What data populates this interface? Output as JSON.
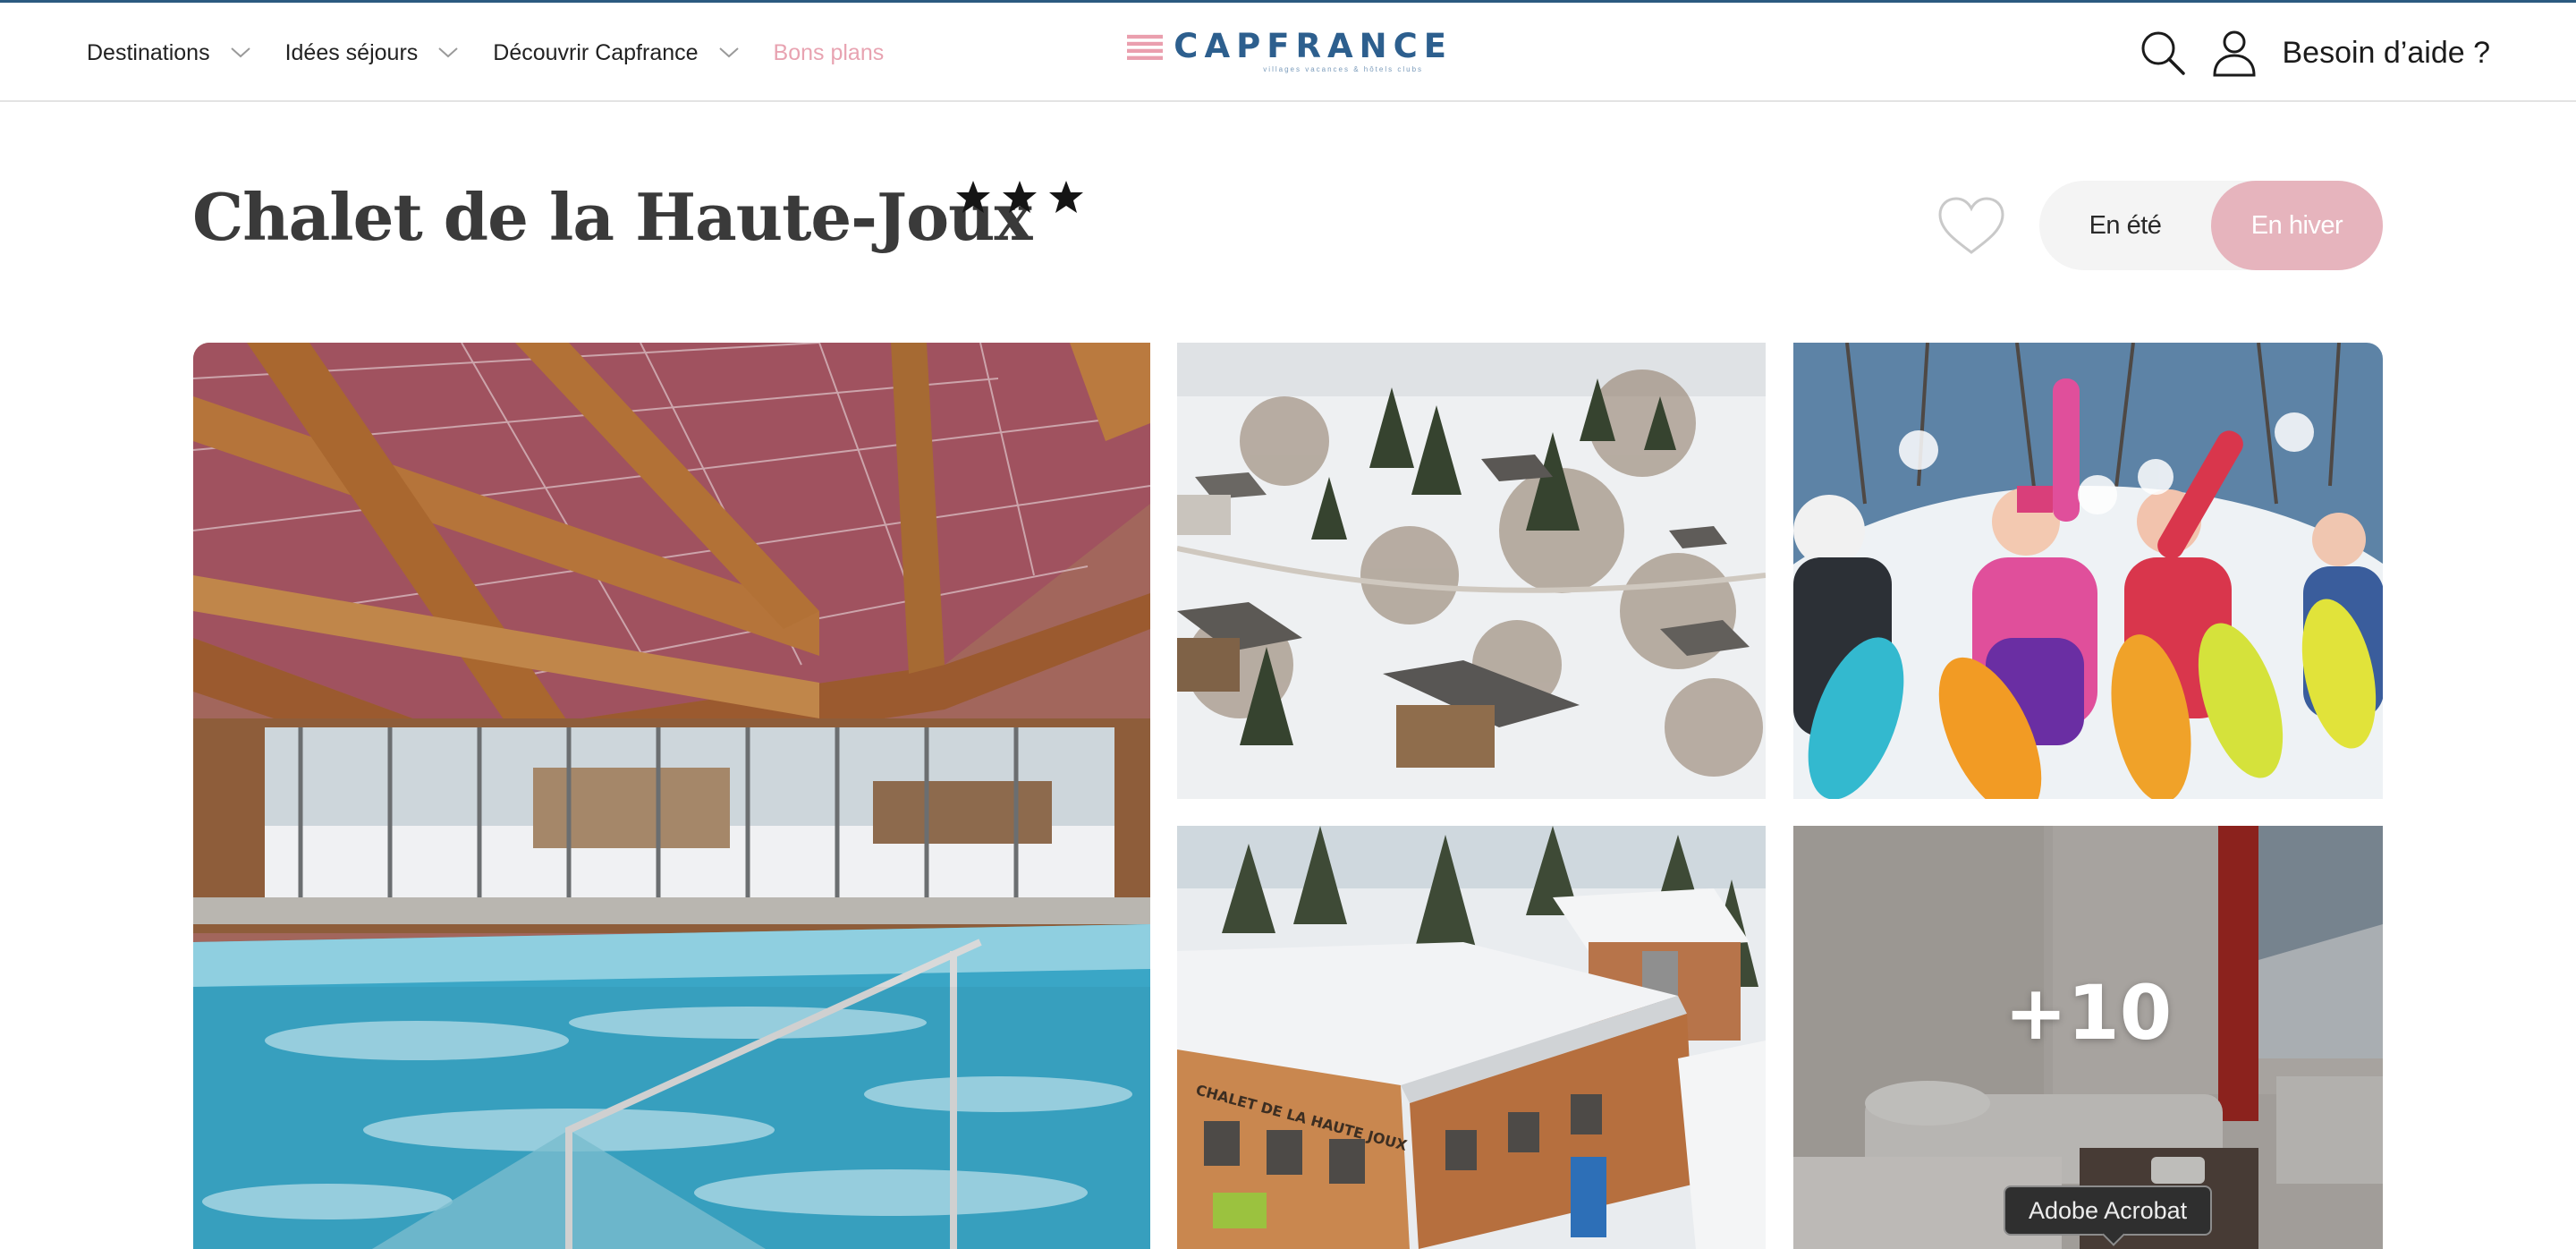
{
  "header": {
    "nav": [
      {
        "label": "Destinations",
        "has_menu": true
      },
      {
        "label": "Idées séjours",
        "has_menu": true
      },
      {
        "label": "Découvrir Capfrance",
        "has_menu": true
      },
      {
        "label": "Bons plans",
        "has_menu": false
      }
    ],
    "logo": {
      "word": "CAPFRANCE",
      "tagline": "villages vacances & hôtels clubs"
    },
    "icons": [
      "search-icon",
      "user-icon"
    ],
    "help_label": "Besoin d’aide ?"
  },
  "property": {
    "name": "Chalet de la Haute-Joux",
    "stars": 3
  },
  "season_toggle": {
    "summer_label": "En été",
    "winter_label": "En hiver",
    "selected": "winter"
  },
  "gallery": {
    "photos": [
      {
        "subject": "indoor pool under wooden roof"
      },
      {
        "subject": "aerial view of snowy village"
      },
      {
        "subject": "children with snowshoes"
      },
      {
        "subject": "chalet building in snow"
      },
      {
        "subject": "bedroom"
      }
    ],
    "more_count": "+10"
  },
  "tooltip": "Adobe Acrobat",
  "colors": {
    "brand_blue": "#2d5f8e",
    "accent_pink": "#e6b4bd",
    "promo_pink": "#e8a3b1",
    "title_gray": "#3a3a3a"
  }
}
